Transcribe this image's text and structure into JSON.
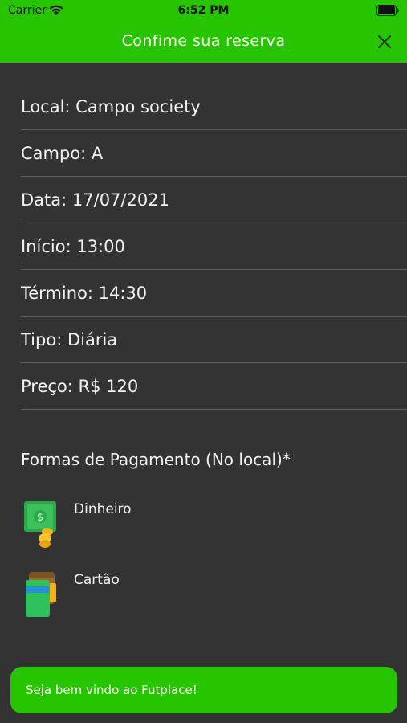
{
  "status_bar": {
    "carrier": "Carrier",
    "time": "6:52 PM"
  },
  "header": {
    "title": "Confime sua reserva"
  },
  "details": [
    {
      "label": "Local: Campo society"
    },
    {
      "label": "Campo: A"
    },
    {
      "label": "Data: 17/07/2021"
    },
    {
      "label": "Início: 13:00"
    },
    {
      "label": "Término: 14:30"
    },
    {
      "label": "Tipo: Diária"
    },
    {
      "label": "Preço: R$ 120"
    }
  ],
  "payments": {
    "title": "Formas de Pagamento (No local)*",
    "items": [
      {
        "label": "Dinheiro",
        "icon": "cash-icon"
      },
      {
        "label": "Cartão",
        "icon": "card-icon"
      }
    ]
  },
  "toast": {
    "message": "Seja bem vindo ao Futplace!"
  },
  "colors": {
    "accent": "#27c400",
    "background": "#333333",
    "divider": "#5e5e5e"
  }
}
